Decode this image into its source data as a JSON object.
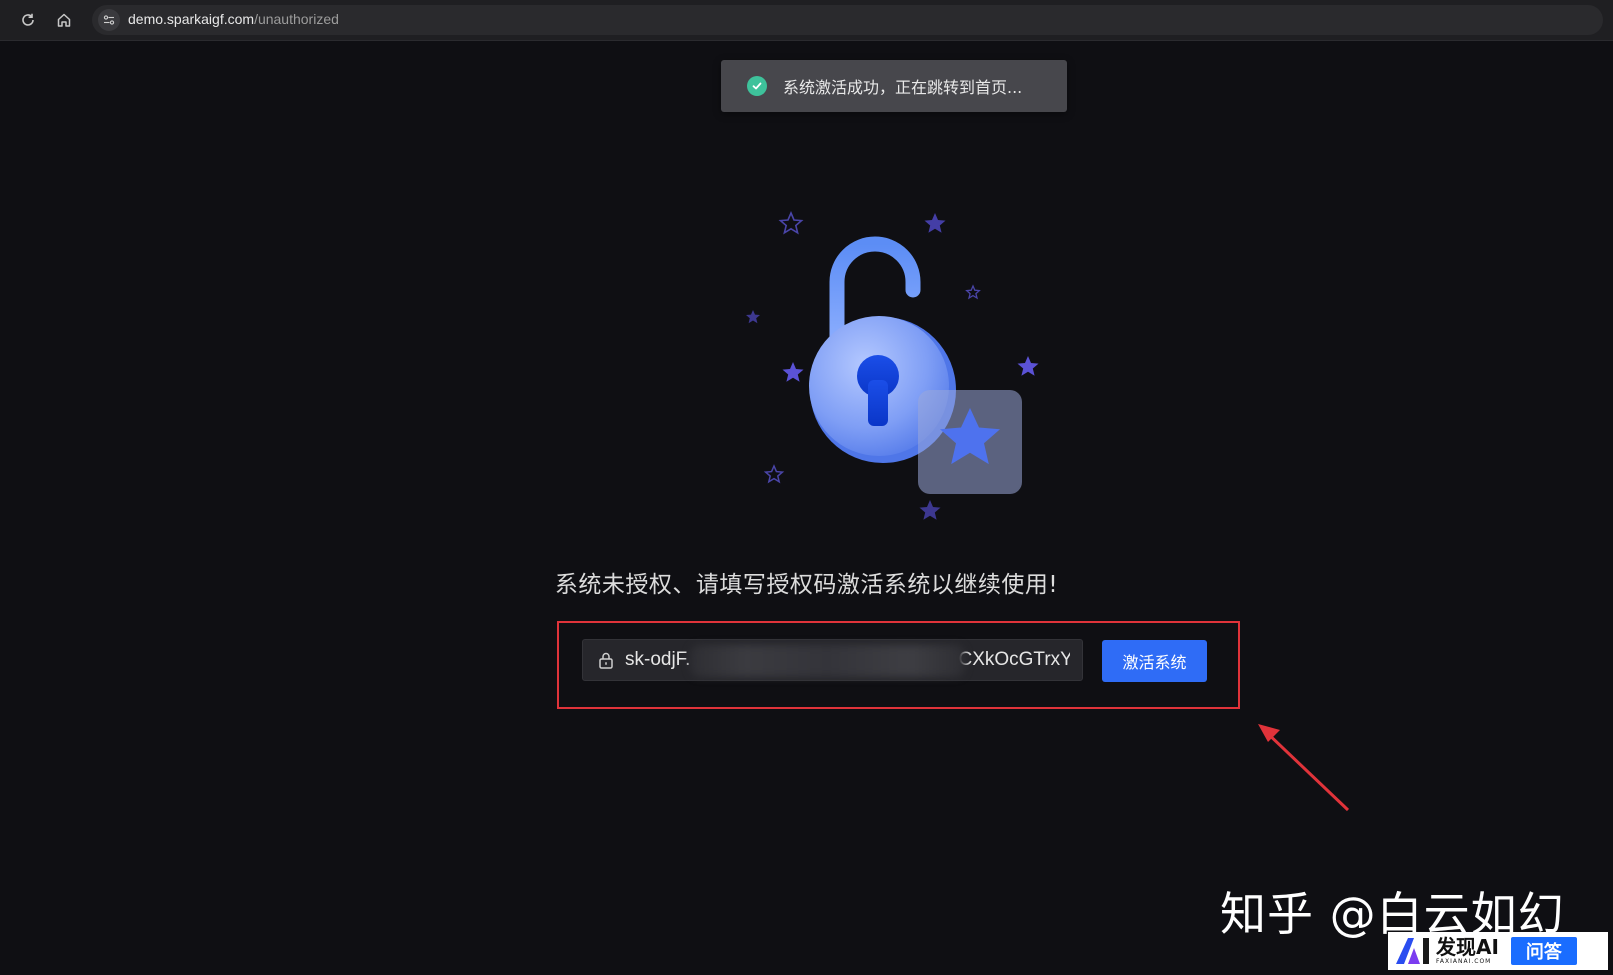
{
  "browser": {
    "url_host": "demo.sparkaigf.com",
    "url_path": "/unauthorized",
    "icons": [
      "reload-icon",
      "home-icon",
      "site-settings-icon"
    ]
  },
  "toast": {
    "message": "系统激活成功，正在跳转到首页...",
    "icon": "check-circle-icon",
    "icon_color": "#3ec29b"
  },
  "main": {
    "message": "系统未授权、请填写授权码激活系统以继续使用!",
    "code_input": {
      "value_visible_prefix": "sk-odjF.",
      "value_visible_suffix": "CXkOcGTrxY",
      "icon": "lock-icon"
    },
    "activate_label": "激活系统",
    "accent_color": "#2f6cf6",
    "highlight_color": "#e0333a"
  },
  "watermark": {
    "zhihu_text": "知乎 @白云如幻",
    "badge_title": "发现AI",
    "badge_subtitle": "FAXIANAI.COM",
    "badge_tag": "问答"
  }
}
